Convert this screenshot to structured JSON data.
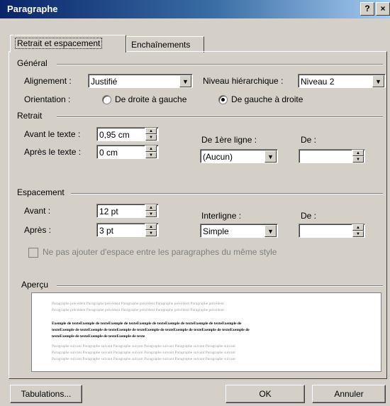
{
  "window": {
    "title": "Paragraphe",
    "help_label": "?",
    "close_label": "×"
  },
  "tabs": [
    {
      "label": "Retrait et espacement",
      "active": true
    },
    {
      "label": "Enchaînements",
      "active": false
    }
  ],
  "general": {
    "group_label": "Général",
    "alignment_label": "Alignement :",
    "alignment_value": "Justifié",
    "level_label": "Niveau hiérarchique :",
    "level_value": "Niveau 2",
    "orientation_label": "Orientation :",
    "rtl_label": "De droite à gauche",
    "ltr_label": "De gauche à droite",
    "selected_orientation": "ltr"
  },
  "indent": {
    "group_label": "Retrait",
    "before_label": "Avant le texte :",
    "before_value": "0,95 cm",
    "after_label": "Après le texte :",
    "after_value": "0 cm",
    "first_line_label": "De 1ère ligne :",
    "first_line_value": "(Aucun)",
    "by_label": "De :",
    "by_value": ""
  },
  "spacing": {
    "group_label": "Espacement",
    "before_label": "Avant :",
    "before_value": "12 pt",
    "after_label": "Après :",
    "after_value": "3 pt",
    "line_label": "Interligne :",
    "line_value": "Simple",
    "at_label": "De :",
    "at_value": "",
    "no_space_label": "Ne pas ajouter d'espace entre les paragraphes du même style",
    "no_space_checked": false
  },
  "preview": {
    "group_label": "Aperçu",
    "prev_line": "Paragraphe précédent Paragraphe précédent Paragraphe précédent Paragraphe précédent Paragraphe précédent",
    "prev_line2": "Paragraphe précédent Paragraphe précédent Paragraphe précédent Paragraphe précédent Paragraphe précédent",
    "sample_line": "Exemple de texteExemple de texteExemple de texteExemple de texteExemple de texteExemple de texteExemple de",
    "sample_line2": "texteExemple de texteExemple de texteExemple de texteExemple de texteExemple de texteExemple de texteExemple de",
    "sample_line3": "texteExemple de texteExemple de texteExemple de texte",
    "next_line": "Paragraphe suivant Paragraphe suivant Paragraphe suivant Paragraphe suivant Paragraphe suivant Paragraphe suivant"
  },
  "buttons": {
    "tabs_label": "Tabulations...",
    "ok_label": "OK",
    "cancel_label": "Annuler"
  }
}
